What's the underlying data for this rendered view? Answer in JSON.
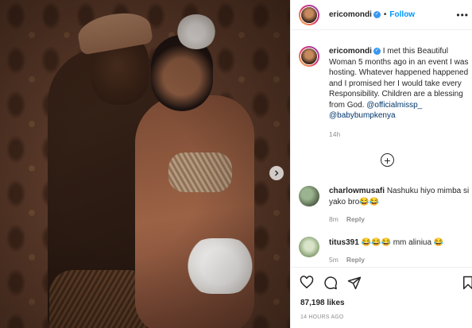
{
  "post": {
    "author": "ericomondi",
    "follow_label": "Follow",
    "dot": "•",
    "more_label": "•••",
    "caption": {
      "author": "ericomondi",
      "text": "I met this Beautiful Woman 5 months ago in an event I was hosting. Whatever happened happened and I promised her I would take every Responsibility. Children are a blessing from God.",
      "mentions": [
        "@officialmissp_",
        "@babybumpkenya"
      ],
      "time": "14h"
    },
    "comments": [
      {
        "user": "charlowmusafi",
        "text": "Nashuku hiyo mimba si yako bro😂😂",
        "time": "8m",
        "reply_label": "Reply"
      },
      {
        "user": "titus391",
        "text": "😂😂😂 mm aliniua 😂",
        "time": "5m",
        "reply_label": "Reply"
      }
    ],
    "likes": "87,198 likes",
    "posted_ago": "14 HOURS AGO"
  },
  "colors": {
    "accent": "#0095f6",
    "mention": "#00376b",
    "muted": "#8e8e8e",
    "verified": "#3897f0"
  },
  "icons": [
    "chevron-right-icon",
    "verified-badge-icon",
    "more-options-icon",
    "add-comment-icon",
    "heart-icon",
    "comment-icon",
    "share-icon",
    "bookmark-icon"
  ]
}
